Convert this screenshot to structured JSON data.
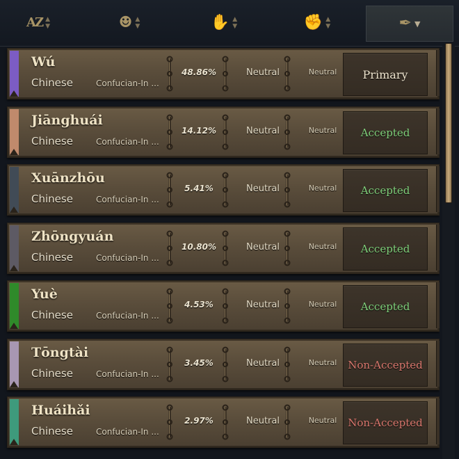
{
  "header": {
    "sort_buttons": [
      {
        "name": "sort-name-button",
        "icon": "az-sort-icon",
        "glyph": "AZ"
      },
      {
        "name": "sort-heritage-button",
        "icon": "heads-icon",
        "glyph": "☻"
      },
      {
        "name": "sort-tradition-button",
        "icon": "hands-exchange-icon",
        "glyph": "✋"
      },
      {
        "name": "sort-attitude-button",
        "icon": "handshake-icon",
        "glyph": "✊"
      },
      {
        "name": "filter-button",
        "icon": "quill-icon",
        "glyph": "✒"
      }
    ],
    "arrow_up": "▲",
    "arrow_down": "▼",
    "dropdown": "▼"
  },
  "cultures": [
    {
      "name": "Wú",
      "heritage": "Chinese",
      "tradition": "Confucian-In ...",
      "percent": "48.86%",
      "attitude": "Neutral",
      "attitude2": "Neutral",
      "status": "Primary",
      "status_kind": "primary",
      "color": "#7c5cc4"
    },
    {
      "name": "Jiānghuái",
      "heritage": "Chinese",
      "tradition": "Confucian-In ...",
      "percent": "14.12%",
      "attitude": "Neutral",
      "attitude2": "Neutral",
      "status": "Accepted",
      "status_kind": "accepted",
      "color": "#c08a6c"
    },
    {
      "name": "Xuānzhōu",
      "heritage": "Chinese",
      "tradition": "Confucian-In ...",
      "percent": "5.41%",
      "attitude": "Neutral",
      "attitude2": "Neutral",
      "status": "Accepted",
      "status_kind": "accepted",
      "color": "#414b56"
    },
    {
      "name": "Zhōngyuán",
      "heritage": "Chinese",
      "tradition": "Confucian-In ...",
      "percent": "10.80%",
      "attitude": "Neutral",
      "attitude2": "Neutral",
      "status": "Accepted",
      "status_kind": "accepted",
      "color": "#5d5a64"
    },
    {
      "name": "Yuè",
      "heritage": "Chinese",
      "tradition": "Confucian-In ...",
      "percent": "4.53%",
      "attitude": "Neutral",
      "attitude2": "Neutral",
      "status": "Accepted",
      "status_kind": "accepted",
      "color": "#2f8a2a"
    },
    {
      "name": "Tōngtài",
      "heritage": "Chinese",
      "tradition": "Confucian-In ...",
      "percent": "3.45%",
      "attitude": "Neutral",
      "attitude2": "Neutral",
      "status": "Non-Accepted",
      "status_kind": "nonaccepted",
      "color": "#a897b2"
    },
    {
      "name": "Huáihǎi",
      "heritage": "Chinese",
      "tradition": "Confucian-In ...",
      "percent": "2.97%",
      "attitude": "Neutral",
      "attitude2": "Neutral",
      "status": "Non-Accepted",
      "status_kind": "nonaccepted",
      "color": "#3e9a7c"
    }
  ],
  "colors": {
    "accepted": "#7fcf7a",
    "non_accepted": "#d9776d",
    "primary": "#f0e6cf",
    "panel": "#5a4d3b"
  }
}
